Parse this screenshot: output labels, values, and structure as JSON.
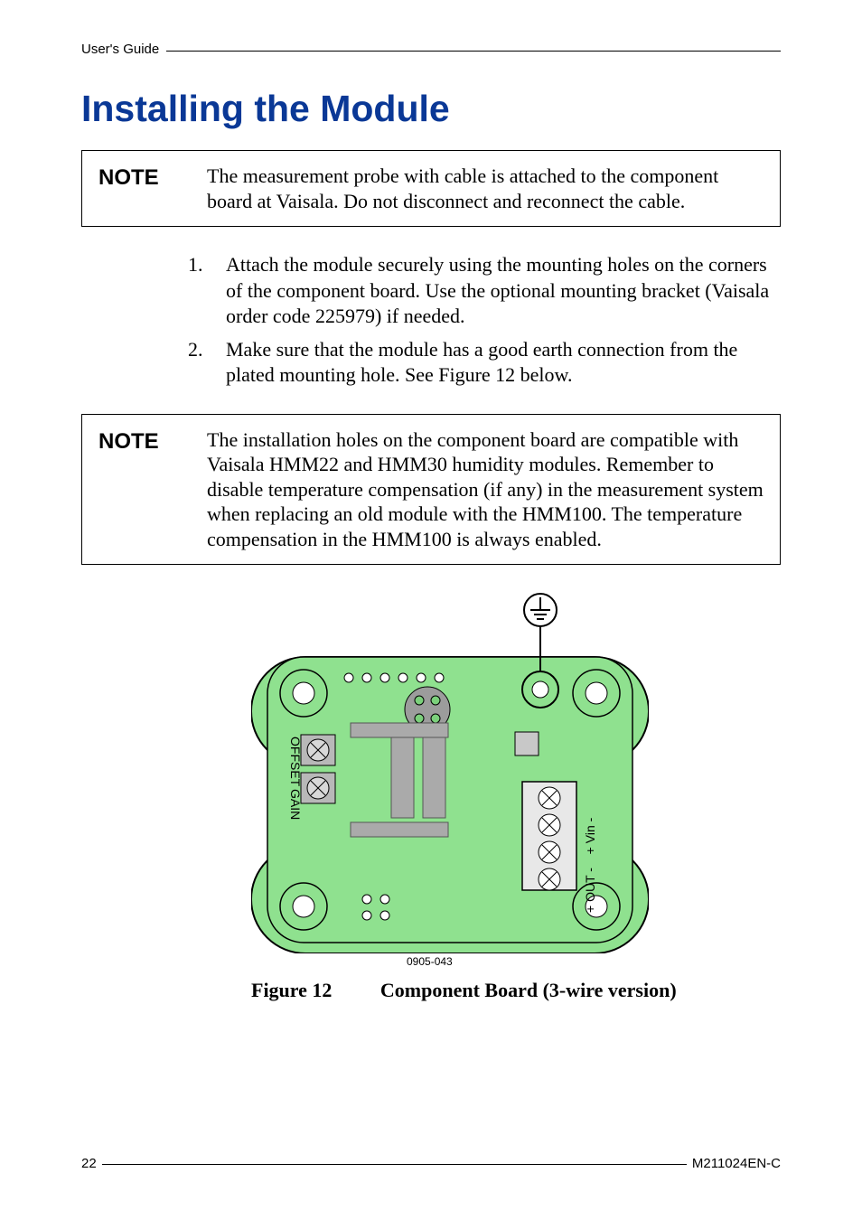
{
  "header": {
    "breadcrumb": "User's Guide"
  },
  "section_title": "Installing the Module",
  "note1": {
    "label": "NOTE",
    "text": "The measurement probe with cable is attached to the component board at Vaisala. Do not disconnect and reconnect the cable."
  },
  "steps": [
    "Attach the module securely using the mounting holes on the corners of the component board. Use the optional mounting bracket (Vaisala order code 225979) if needed.",
    "Make sure that the module has a good earth connection from the plated mounting hole. See Figure 12 below."
  ],
  "note2": {
    "label": "NOTE",
    "text": "The installation holes on the component board are compatible with Vaisala HMM22 and HMM30 humidity modules. Remember to disable temperature compensation (if any) in the measurement system when replacing an old module with the HMM100. The temperature compensation in the HMM100 is always enabled."
  },
  "figure": {
    "image_id": "0905-043",
    "caption_label": "Figure 12",
    "caption_text": "Component Board (3-wire version)",
    "labels": {
      "offset": "OFFSET",
      "gain": "GAIN",
      "vin": "+ Vin -",
      "out": "+ OUT -"
    }
  },
  "footer": {
    "page_number": "22",
    "doc_number": "M211024EN-C"
  }
}
